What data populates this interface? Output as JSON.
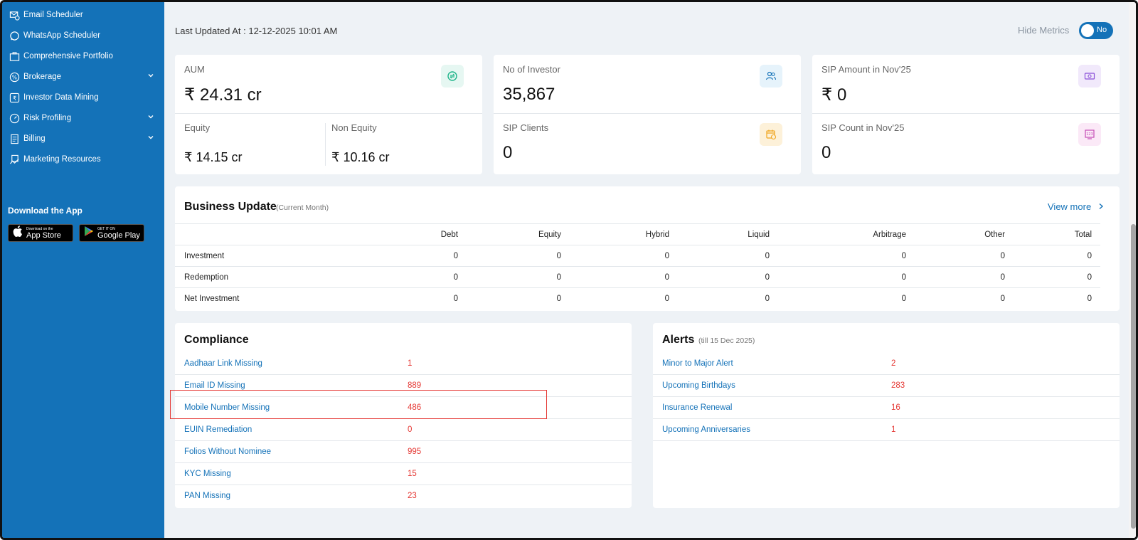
{
  "sidebar": {
    "items": [
      {
        "label": "Email Scheduler",
        "icon": "email-scheduler-icon"
      },
      {
        "label": "WhatsApp Scheduler",
        "icon": "whatsapp-icon"
      },
      {
        "label": "Comprehensive Portfolio",
        "icon": "portfolio-icon"
      },
      {
        "label": "Brokerage",
        "icon": "percent-icon"
      },
      {
        "label": "Investor Data Mining",
        "icon": "rupee-icon"
      },
      {
        "label": "Risk Profiling",
        "icon": "gauge-icon"
      },
      {
        "label": "Billing",
        "icon": "billing-icon"
      },
      {
        "label": "Marketing Resources",
        "icon": "marketing-icon"
      }
    ],
    "download_title": "Download the App",
    "app_store_small": "Download on the",
    "app_store_big": "App Store",
    "play_small": "GET IT ON",
    "play_big": "Google Play"
  },
  "header": {
    "last_updated": "Last Updated At : 12-12-2025 10:01 AM",
    "hide_metrics_label": "Hide Metrics",
    "toggle_value": "No"
  },
  "metrics": {
    "aum_label": "AUM",
    "aum_value": "₹  24.31 cr",
    "equity_label": "Equity",
    "equity_value": "₹  14.15 cr",
    "non_equity_label": "Non Equity",
    "non_equity_value": "₹  10.16 cr",
    "investors_label": "No of Investor",
    "investors_value": "35,867",
    "sip_clients_label": "SIP Clients",
    "sip_clients_value": "0",
    "sip_amount_label": "SIP Amount in Nov'25",
    "sip_amount_value": "₹  0",
    "sip_count_label": "SIP Count in Nov'25",
    "sip_count_value": "0",
    "colors": {
      "aum": "#e6f7f2",
      "investor": "#e6f3fb",
      "sip_clients": "#fdf1d9",
      "sip_amount": "#f1e9fb",
      "sip_count": "#fbe9f7"
    }
  },
  "business_update": {
    "title": "Business Update",
    "subtitle": "(Current Month)",
    "view_more": "View more",
    "columns": [
      "Debt",
      "Equity",
      "Hybrid",
      "Liquid",
      "Arbitrage",
      "Other",
      "Total"
    ],
    "rows": [
      {
        "label": "Investment",
        "values": [
          "0",
          "0",
          "0",
          "0",
          "0",
          "0",
          "0"
        ]
      },
      {
        "label": "Redemption",
        "values": [
          "0",
          "0",
          "0",
          "0",
          "0",
          "0",
          "0"
        ]
      },
      {
        "label": "Net Investment",
        "values": [
          "0",
          "0",
          "0",
          "0",
          "0",
          "0",
          "0"
        ]
      }
    ]
  },
  "compliance": {
    "title": "Compliance",
    "items": [
      {
        "label": "Aadhaar Link Missing",
        "value": "1"
      },
      {
        "label": "Email ID Missing",
        "value": "889"
      },
      {
        "label": "Mobile Number Missing",
        "value": "486"
      },
      {
        "label": "EUIN Remediation",
        "value": "0"
      },
      {
        "label": "Folios Without Nominee",
        "value": "995"
      },
      {
        "label": "KYC Missing",
        "value": "15"
      },
      {
        "label": "PAN Missing",
        "value": "23"
      }
    ]
  },
  "alerts": {
    "title": "Alerts",
    "subtitle": "(till 15 Dec 2025)",
    "items": [
      {
        "label": "Minor to Major Alert",
        "value": "2"
      },
      {
        "label": "Upcoming Birthdays",
        "value": "283"
      },
      {
        "label": "Insurance Renewal",
        "value": "16"
      },
      {
        "label": "Upcoming Anniversaries",
        "value": "1"
      }
    ]
  }
}
